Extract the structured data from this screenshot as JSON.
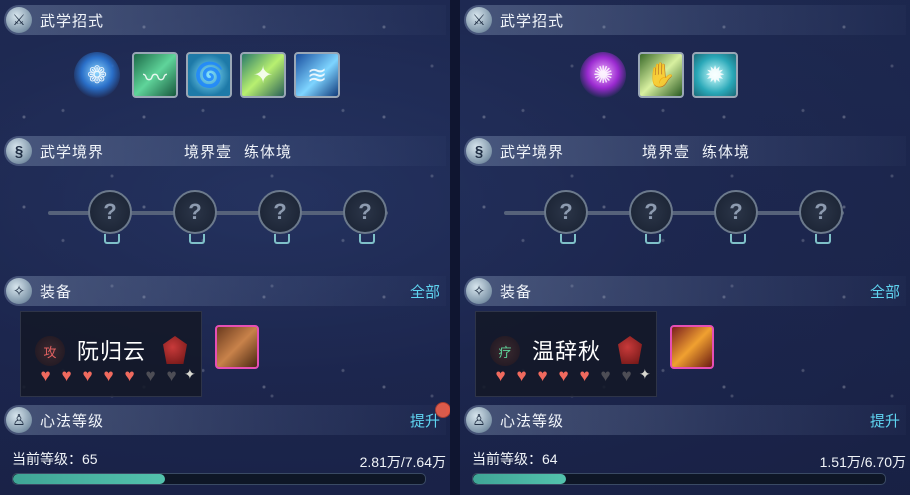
{
  "panels": [
    {
      "skills_header": "武学招式",
      "realm_header": "武学境界",
      "realm_level": "境界壹",
      "realm_stage": "练体境",
      "equip_header": "装备",
      "equip_all": "全部",
      "character": {
        "badge": "攻",
        "name": "阮归云",
        "hearts_full": 5,
        "hearts_total": 7
      },
      "mind_header": "心法等级",
      "mind_action": "提升",
      "level_label": "当前等级：65",
      "exp_text": "2.81万/7.64万",
      "exp_progress": 0.368
    },
    {
      "skills_header": "武学招式",
      "realm_header": "武学境界",
      "realm_level": "境界壹",
      "realm_stage": "练体境",
      "equip_header": "装备",
      "equip_all": "全部",
      "character": {
        "badge": "疗",
        "name": "温辞秋",
        "hearts_full": 5,
        "hearts_total": 7
      },
      "mind_header": "心法等级",
      "mind_action": "提升",
      "level_label": "当前等级：64",
      "exp_text": "1.51万/6.70万",
      "exp_progress": 0.225
    }
  ],
  "colors": {
    "accent_link": "#5fd4f0",
    "heart_full": "#f06a5e",
    "exp_fill": "#53c2ad",
    "rare_border": "#e64fb4"
  }
}
